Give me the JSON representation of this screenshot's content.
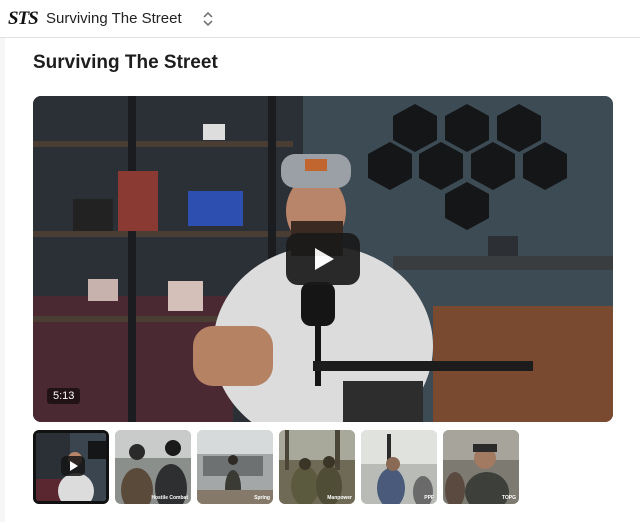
{
  "header": {
    "logo_text": "STS",
    "channel_name": "Surviving The Street"
  },
  "main": {
    "title": "Surviving The Street",
    "player": {
      "duration": "5:13"
    },
    "thumbnails": [
      {
        "caption": "",
        "active": true
      },
      {
        "caption": "Hostile Combat",
        "active": false
      },
      {
        "caption": "Spring",
        "active": false
      },
      {
        "caption": "Manpower",
        "active": false
      },
      {
        "caption": "PPF",
        "active": false
      },
      {
        "caption": "TOPG",
        "active": false
      }
    ]
  }
}
